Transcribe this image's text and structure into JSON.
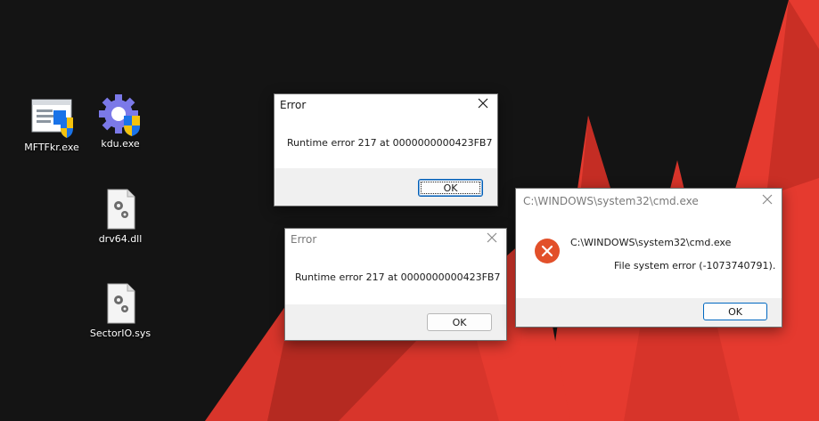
{
  "colors": {
    "background": "#141414",
    "wallpaper_red": "#e53a2f",
    "wallpaper_red_dark": "#b32920",
    "error_icon": "#e2502a",
    "ok_default_border": "#0067c0"
  },
  "desktop_icons": [
    {
      "label": "MFTFkr.exe",
      "icon": "app-window-shield-icon"
    },
    {
      "label": "kdu.exe",
      "icon": "gear-shield-icon"
    },
    {
      "label": "drv64.dll",
      "icon": "settings-file-icon"
    },
    {
      "label": "SectorIO.sys",
      "icon": "settings-file-icon"
    }
  ],
  "dialogs": {
    "error_top": {
      "title": "Error",
      "message": "Runtime error 217 at 0000000000423FB7",
      "ok_label": "OK"
    },
    "error_bottom": {
      "title": "Error",
      "message": "Runtime error 217 at 0000000000423FB7",
      "ok_label": "OK"
    },
    "cmd_error": {
      "title": "C:\\WINDOWS\\system32\\cmd.exe",
      "heading": "C:\\WINDOWS\\system32\\cmd.exe",
      "message": "File system error (-1073740791).",
      "ok_label": "OK",
      "icon": "error-x-icon"
    }
  }
}
